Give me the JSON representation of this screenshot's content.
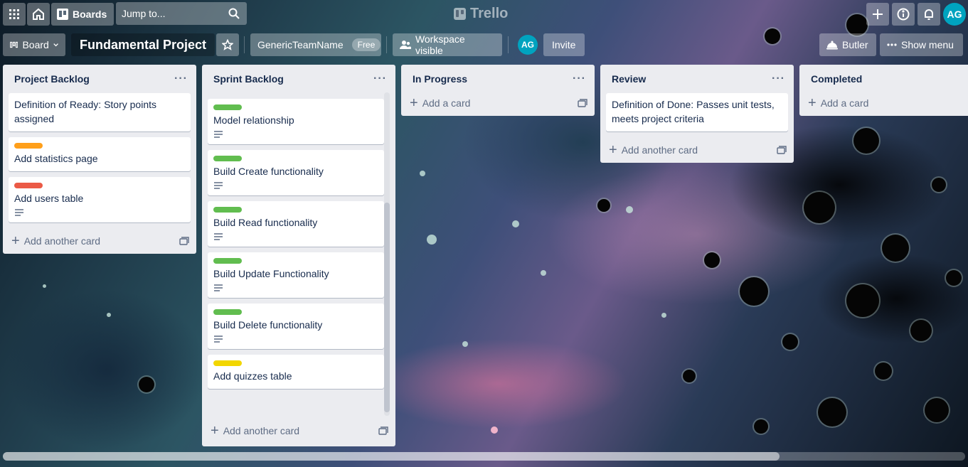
{
  "topbar": {
    "boards_label": "Boards",
    "search_placeholder": "Jump to...",
    "logo_text": "Trello",
    "avatar_initials": "AG"
  },
  "board_header": {
    "view_label": "Board",
    "title": "Fundamental Project",
    "team_name": "GenericTeamName",
    "team_plan": "Free",
    "visibility_label": "Workspace visible",
    "member_initials": "AG",
    "invite_label": "Invite",
    "butler_label": "Butler",
    "show_menu_label": "Show menu"
  },
  "lists": [
    {
      "title": "Project Backlog",
      "cards": [
        {
          "title": "Definition of Ready: Story points assigned"
        },
        {
          "title": "Add statistics page",
          "label_color": "#ff9f1a"
        },
        {
          "title": "Add users table",
          "label_color": "#eb5a46",
          "has_description": true
        }
      ],
      "add_label": "Add another card"
    },
    {
      "title": "Sprint Backlog",
      "cards": [
        {
          "title": "Model relationship",
          "label_color": "#61bd4f",
          "has_description": true
        },
        {
          "title": "Build Create functionality",
          "label_color": "#61bd4f",
          "has_description": true
        },
        {
          "title": "Build Read functionality",
          "label_color": "#61bd4f",
          "has_description": true
        },
        {
          "title": "Build Update Functionality",
          "label_color": "#61bd4f",
          "has_description": true
        },
        {
          "title": "Build Delete functionality",
          "label_color": "#61bd4f",
          "has_description": true
        },
        {
          "title": "Add quizzes table",
          "label_color": "#f2d600"
        }
      ],
      "add_label": "Add another card"
    },
    {
      "title": "In Progress",
      "cards": [],
      "add_label": "Add a card"
    },
    {
      "title": "Review",
      "cards": [
        {
          "title": "Definition of Done: Passes unit tests, meets project criteria"
        }
      ],
      "add_label": "Add another card"
    },
    {
      "title": "Completed",
      "cards": [],
      "add_label": "Add a card"
    }
  ],
  "icons": {
    "apps": "apps-grid-icon",
    "home": "home-icon",
    "boards": "boards-icon",
    "search": "search-icon",
    "plus": "plus-icon",
    "info": "info-icon",
    "bell": "bell-icon",
    "star": "star-icon",
    "visibility": "people-icon",
    "butler": "butler-icon",
    "menu": "more-icon",
    "description": "description-icon",
    "template": "card-template-icon"
  },
  "colors": {
    "label_orange": "#ff9f1a",
    "label_red": "#eb5a46",
    "label_green": "#61bd4f",
    "label_yellow": "#f2d600",
    "avatar": "#00a3bf"
  }
}
